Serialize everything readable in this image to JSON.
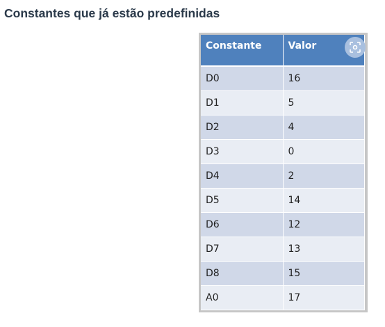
{
  "title": "Constantes que já estão predefinidas",
  "table": {
    "headers": [
      "Constante",
      "Valor"
    ],
    "rows": [
      [
        "D0",
        "16"
      ],
      [
        "D1",
        "5"
      ],
      [
        "D2",
        "4"
      ],
      [
        "D3",
        "0"
      ],
      [
        "D4",
        "2"
      ],
      [
        "D5",
        "14"
      ],
      [
        "D6",
        "12"
      ],
      [
        "D7",
        "13"
      ],
      [
        "D8",
        "15"
      ],
      [
        "A0",
        "17"
      ]
    ]
  },
  "icons": {
    "visual_search": "visual-search-icon"
  }
}
